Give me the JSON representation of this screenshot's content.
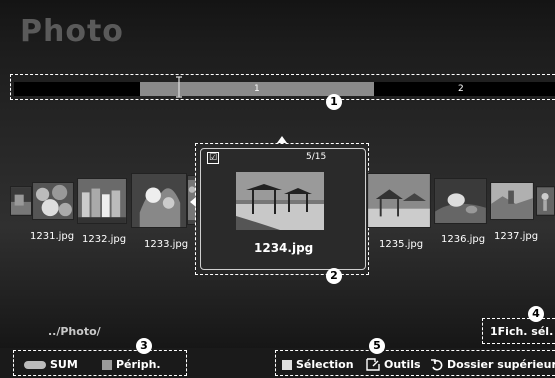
{
  "app": {
    "title": "Photo"
  },
  "timeline": {
    "labels": [
      "1",
      "2"
    ],
    "callout": "1"
  },
  "photos": [
    {
      "name": "1231.jpg"
    },
    {
      "name": "1232.jpg"
    },
    {
      "name": "1233.jpg"
    },
    {
      "name": "1234.jpg"
    },
    {
      "name": "1235.jpg"
    },
    {
      "name": "1236.jpg"
    },
    {
      "name": "1237.jpg"
    }
  ],
  "focus": {
    "name": "1234.jpg",
    "count": "5/15",
    "checked": "☑",
    "callout": "2"
  },
  "path": "../Photo/",
  "selected": {
    "label": "1Fich. sél.",
    "callout": "4"
  },
  "bottom": {
    "sum_label": "SUM",
    "periph_label": "Périph.",
    "source_callout": "3",
    "select_label": "Sélection",
    "tools_label": "Outils",
    "parent_label": "Dossier supérieur",
    "tools_callout": "5"
  },
  "colors": {
    "accent": "#8a8a8a",
    "select": "#e0e0e0",
    "periph": "#9a9a9a"
  }
}
